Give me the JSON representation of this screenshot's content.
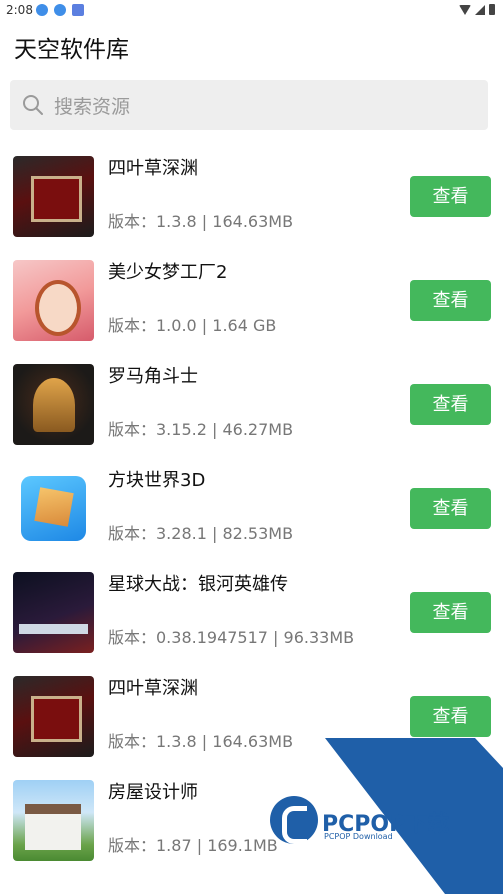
{
  "status_bar": {
    "time": "2:08"
  },
  "header": {
    "title": "天空软件库"
  },
  "search": {
    "placeholder": "搜索资源"
  },
  "apps": [
    {
      "name": "四叶草深渊",
      "meta": "版本：1.3.8 | 164.63MB",
      "button": "查看"
    },
    {
      "name": "美少女梦工厂2",
      "meta": "版本：1.0.0 | 1.64 GB",
      "button": "查看"
    },
    {
      "name": "罗马角斗士",
      "meta": "版本：3.15.2 | 46.27MB",
      "button": "查看"
    },
    {
      "name": "方块世界3D",
      "meta": "版本：3.28.1 | 82.53MB",
      "button": "查看"
    },
    {
      "name": "星球大战：银河英雄传",
      "meta": "版本：0.38.1947517 | 96.33MB",
      "button": "查看"
    },
    {
      "name": "四叶草深渊",
      "meta": "版本：1.3.8 | 164.63MB",
      "button": "查看"
    },
    {
      "name": "房屋设计师",
      "meta": "版本：1.87 | 169.1MB",
      "button": ""
    }
  ],
  "watermark": {
    "brand": "PCPOP下载",
    "sub": "PCPOP Download"
  },
  "colors": {
    "accent": "#44b85c",
    "search_bg": "#eeeeee",
    "watermark": "#1f5fa8"
  }
}
